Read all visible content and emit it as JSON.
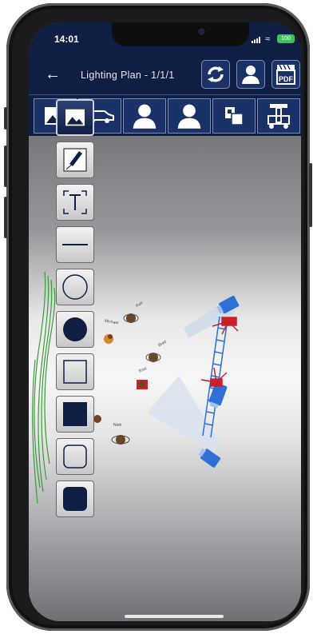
{
  "status": {
    "time": "14:01",
    "battery": "100"
  },
  "nav": {
    "back_icon": "back-arrow-icon",
    "title": "Lighting Plan - 1/1/1"
  },
  "top_actions": [
    "rotate-arrows-icon",
    "person-icon",
    "pdf-export-icon"
  ],
  "toolbar": [
    "image-icon",
    "car-icon",
    "person-icon",
    "person-icon",
    "crate-icon",
    "grip-cart-icon"
  ],
  "palette": [
    "image-icon",
    "pen-icon",
    "text-icon",
    "line-icon",
    "circle-outline-icon",
    "circle-filled-icon",
    "square-outline-icon",
    "square-filled-icon",
    "rounded-square-outline-icon",
    "rounded-square-filled-icon"
  ],
  "actors": [
    {
      "label": "Kurt"
    },
    {
      "label": "Michael"
    },
    {
      "label": "Brad"
    },
    {
      "label": "Emil"
    },
    {
      "label": "Ninh"
    }
  ],
  "colors": {
    "navy": "#0f1f44",
    "light_blue": "#2f6fd6",
    "stand_red": "#c8202c",
    "actor_brown": "#6b4522",
    "scribble_green": "#3c9a3a"
  }
}
